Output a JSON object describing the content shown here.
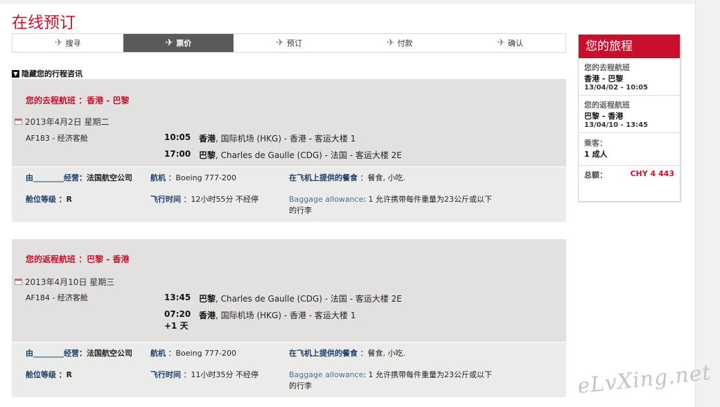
{
  "page": {
    "title": "在线预订"
  },
  "steps": [
    {
      "label": "搜寻",
      "active": false
    },
    {
      "label": "票价",
      "active": true
    },
    {
      "label": "预订",
      "active": false
    },
    {
      "label": "付款",
      "active": false
    },
    {
      "label": "确认",
      "active": false
    }
  ],
  "toggle_label": "隐藏您的行程咨讯",
  "outbound": {
    "heading": "您的去程航班 ：香港 - 巴黎",
    "date": "2013年4月2日 星期二",
    "flight": "AF183 - 经济客舱",
    "dep_time": "10:05",
    "dep_city": "香港",
    "dep_place": ", 国际机场 (HKG) - 香港 - 客运大楼 1",
    "arr_time": "17:00",
    "arr_city": "巴黎",
    "arr_place": ", Charles de Gaulle (CDG) - 法国 - 客运大楼 2E",
    "operated_label": "由________经营",
    "operated_value": "：法国航空公司",
    "aircraft_label": "航机",
    "aircraft_value": "：Boeing 777-200",
    "meal_label": "在飞机上提供的餐食",
    "meal_value": "：餐食, 小吃.",
    "class_label": "舱位等级",
    "class_value": "：R",
    "duration_label": "飞行时间",
    "duration_value": "：12小时55分 不经停",
    "baggage_label": "Baggage allowance",
    "baggage_value": ": 1 允许携带每件重量为23公斤或以下的行李"
  },
  "inbound": {
    "heading": "您的返程航班 ：巴黎 - 香港",
    "date": "2013年4月10日 星期三",
    "flight": "AF184 - 经济客舱",
    "dep_time": "13:45",
    "dep_city": "巴黎",
    "dep_place": ", Charles de Gaulle (CDG) - 法国 - 客运大楼 2E",
    "arr_time": "07:20",
    "arr_plus": "+1 天",
    "arr_city": "香港",
    "arr_place": ", 国际机场 (HKG) - 香港 - 客运大楼 1",
    "operated_label": "由________经营",
    "operated_value": "：法国航空公司",
    "aircraft_label": "航机",
    "aircraft_value": "：Boeing 777-200",
    "meal_label": "在飞机上提供的餐食",
    "meal_value": "：餐食, 小吃.",
    "class_label": "舱位等级",
    "class_value": "：R",
    "duration_label": "飞行时间",
    "duration_value": "：11小时35分 不经停",
    "baggage_label": "Baggage allowance",
    "baggage_value": ": 1 允许携带每件重量为23公斤或以下的行李"
  },
  "sidebar": {
    "title": "您的旅程",
    "out_label": "您的去程航班",
    "out_route": "香港 - 巴黎",
    "out_time": "13/04/02 - 10:05",
    "ret_label": "您的返程航班",
    "ret_route": "巴黎 - 香港",
    "ret_time": "13/04/10 - 13:45",
    "pax_label": "乘客：",
    "pax_value": "1 成人",
    "total_label": "总额：",
    "total_value": "CHY 4 443"
  },
  "watermark": "eLvXing.net",
  "colors": {
    "brand": "#c8102e",
    "active_step": "#5a5a5a",
    "card_bg": "#e2e1df"
  }
}
